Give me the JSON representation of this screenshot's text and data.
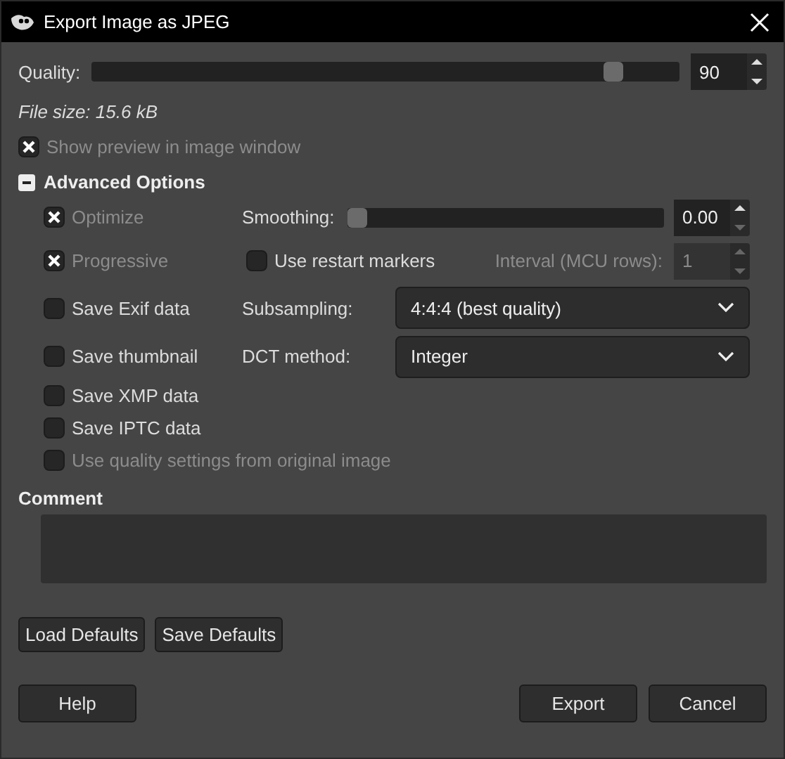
{
  "window": {
    "title": "Export Image as JPEG"
  },
  "quality": {
    "label": "Quality:",
    "level": 0.9,
    "value": "90"
  },
  "file_size": "File size: 15.6 kB",
  "show_preview": {
    "label": "Show preview in image window",
    "checked": true,
    "disabled": true
  },
  "advanced": {
    "label": "Advanced Options",
    "expanded": true,
    "options": [
      {
        "label": "Optimize",
        "checked": true,
        "disabled": true
      },
      {
        "label": "Progressive",
        "checked": true,
        "disabled": true
      },
      {
        "label": "Save Exif data",
        "checked": false,
        "disabled": false
      },
      {
        "label": "Save thumbnail",
        "checked": false,
        "disabled": false
      },
      {
        "label": "Save XMP data",
        "checked": false,
        "disabled": false
      },
      {
        "label": "Save IPTC data",
        "checked": false,
        "disabled": false
      },
      {
        "label": "Use quality settings from original image",
        "checked": false,
        "disabled": true
      }
    ],
    "smoothing": {
      "label": "Smoothing:",
      "level": 0,
      "value": "0.00"
    },
    "restart_markers": {
      "label": "Use restart markers",
      "checked": false,
      "disabled": false
    },
    "interval": {
      "label": "Interval (MCU rows):",
      "value": "1",
      "disabled": true
    },
    "subsampling": {
      "label": "Subsampling:",
      "value": "4:4:4 (best quality)"
    },
    "dct_method": {
      "label": "DCT method:",
      "value": "Integer"
    }
  },
  "comment": {
    "label": "Comment"
  },
  "default_buttons": [
    "Load Defaults",
    "Save Defaults"
  ],
  "buttons": [
    "Help",
    "Export",
    "Cancel"
  ]
}
